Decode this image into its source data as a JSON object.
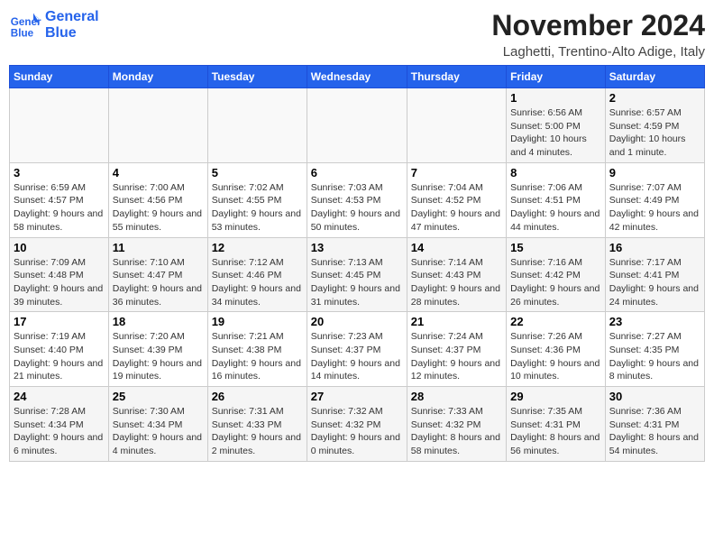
{
  "logo": {
    "line1": "General",
    "line2": "Blue"
  },
  "title": "November 2024",
  "location": "Laghetti, Trentino-Alto Adige, Italy",
  "days_of_week": [
    "Sunday",
    "Monday",
    "Tuesday",
    "Wednesday",
    "Thursday",
    "Friday",
    "Saturday"
  ],
  "weeks": [
    [
      {
        "day": "",
        "info": ""
      },
      {
        "day": "",
        "info": ""
      },
      {
        "day": "",
        "info": ""
      },
      {
        "day": "",
        "info": ""
      },
      {
        "day": "",
        "info": ""
      },
      {
        "day": "1",
        "info": "Sunrise: 6:56 AM\nSunset: 5:00 PM\nDaylight: 10 hours and 4 minutes."
      },
      {
        "day": "2",
        "info": "Sunrise: 6:57 AM\nSunset: 4:59 PM\nDaylight: 10 hours and 1 minute."
      }
    ],
    [
      {
        "day": "3",
        "info": "Sunrise: 6:59 AM\nSunset: 4:57 PM\nDaylight: 9 hours and 58 minutes."
      },
      {
        "day": "4",
        "info": "Sunrise: 7:00 AM\nSunset: 4:56 PM\nDaylight: 9 hours and 55 minutes."
      },
      {
        "day": "5",
        "info": "Sunrise: 7:02 AM\nSunset: 4:55 PM\nDaylight: 9 hours and 53 minutes."
      },
      {
        "day": "6",
        "info": "Sunrise: 7:03 AM\nSunset: 4:53 PM\nDaylight: 9 hours and 50 minutes."
      },
      {
        "day": "7",
        "info": "Sunrise: 7:04 AM\nSunset: 4:52 PM\nDaylight: 9 hours and 47 minutes."
      },
      {
        "day": "8",
        "info": "Sunrise: 7:06 AM\nSunset: 4:51 PM\nDaylight: 9 hours and 44 minutes."
      },
      {
        "day": "9",
        "info": "Sunrise: 7:07 AM\nSunset: 4:49 PM\nDaylight: 9 hours and 42 minutes."
      }
    ],
    [
      {
        "day": "10",
        "info": "Sunrise: 7:09 AM\nSunset: 4:48 PM\nDaylight: 9 hours and 39 minutes."
      },
      {
        "day": "11",
        "info": "Sunrise: 7:10 AM\nSunset: 4:47 PM\nDaylight: 9 hours and 36 minutes."
      },
      {
        "day": "12",
        "info": "Sunrise: 7:12 AM\nSunset: 4:46 PM\nDaylight: 9 hours and 34 minutes."
      },
      {
        "day": "13",
        "info": "Sunrise: 7:13 AM\nSunset: 4:45 PM\nDaylight: 9 hours and 31 minutes."
      },
      {
        "day": "14",
        "info": "Sunrise: 7:14 AM\nSunset: 4:43 PM\nDaylight: 9 hours and 28 minutes."
      },
      {
        "day": "15",
        "info": "Sunrise: 7:16 AM\nSunset: 4:42 PM\nDaylight: 9 hours and 26 minutes."
      },
      {
        "day": "16",
        "info": "Sunrise: 7:17 AM\nSunset: 4:41 PM\nDaylight: 9 hours and 24 minutes."
      }
    ],
    [
      {
        "day": "17",
        "info": "Sunrise: 7:19 AM\nSunset: 4:40 PM\nDaylight: 9 hours and 21 minutes."
      },
      {
        "day": "18",
        "info": "Sunrise: 7:20 AM\nSunset: 4:39 PM\nDaylight: 9 hours and 19 minutes."
      },
      {
        "day": "19",
        "info": "Sunrise: 7:21 AM\nSunset: 4:38 PM\nDaylight: 9 hours and 16 minutes."
      },
      {
        "day": "20",
        "info": "Sunrise: 7:23 AM\nSunset: 4:37 PM\nDaylight: 9 hours and 14 minutes."
      },
      {
        "day": "21",
        "info": "Sunrise: 7:24 AM\nSunset: 4:37 PM\nDaylight: 9 hours and 12 minutes."
      },
      {
        "day": "22",
        "info": "Sunrise: 7:26 AM\nSunset: 4:36 PM\nDaylight: 9 hours and 10 minutes."
      },
      {
        "day": "23",
        "info": "Sunrise: 7:27 AM\nSunset: 4:35 PM\nDaylight: 9 hours and 8 minutes."
      }
    ],
    [
      {
        "day": "24",
        "info": "Sunrise: 7:28 AM\nSunset: 4:34 PM\nDaylight: 9 hours and 6 minutes."
      },
      {
        "day": "25",
        "info": "Sunrise: 7:30 AM\nSunset: 4:34 PM\nDaylight: 9 hours and 4 minutes."
      },
      {
        "day": "26",
        "info": "Sunrise: 7:31 AM\nSunset: 4:33 PM\nDaylight: 9 hours and 2 minutes."
      },
      {
        "day": "27",
        "info": "Sunrise: 7:32 AM\nSunset: 4:32 PM\nDaylight: 9 hours and 0 minutes."
      },
      {
        "day": "28",
        "info": "Sunrise: 7:33 AM\nSunset: 4:32 PM\nDaylight: 8 hours and 58 minutes."
      },
      {
        "day": "29",
        "info": "Sunrise: 7:35 AM\nSunset: 4:31 PM\nDaylight: 8 hours and 56 minutes."
      },
      {
        "day": "30",
        "info": "Sunrise: 7:36 AM\nSunset: 4:31 PM\nDaylight: 8 hours and 54 minutes."
      }
    ]
  ]
}
